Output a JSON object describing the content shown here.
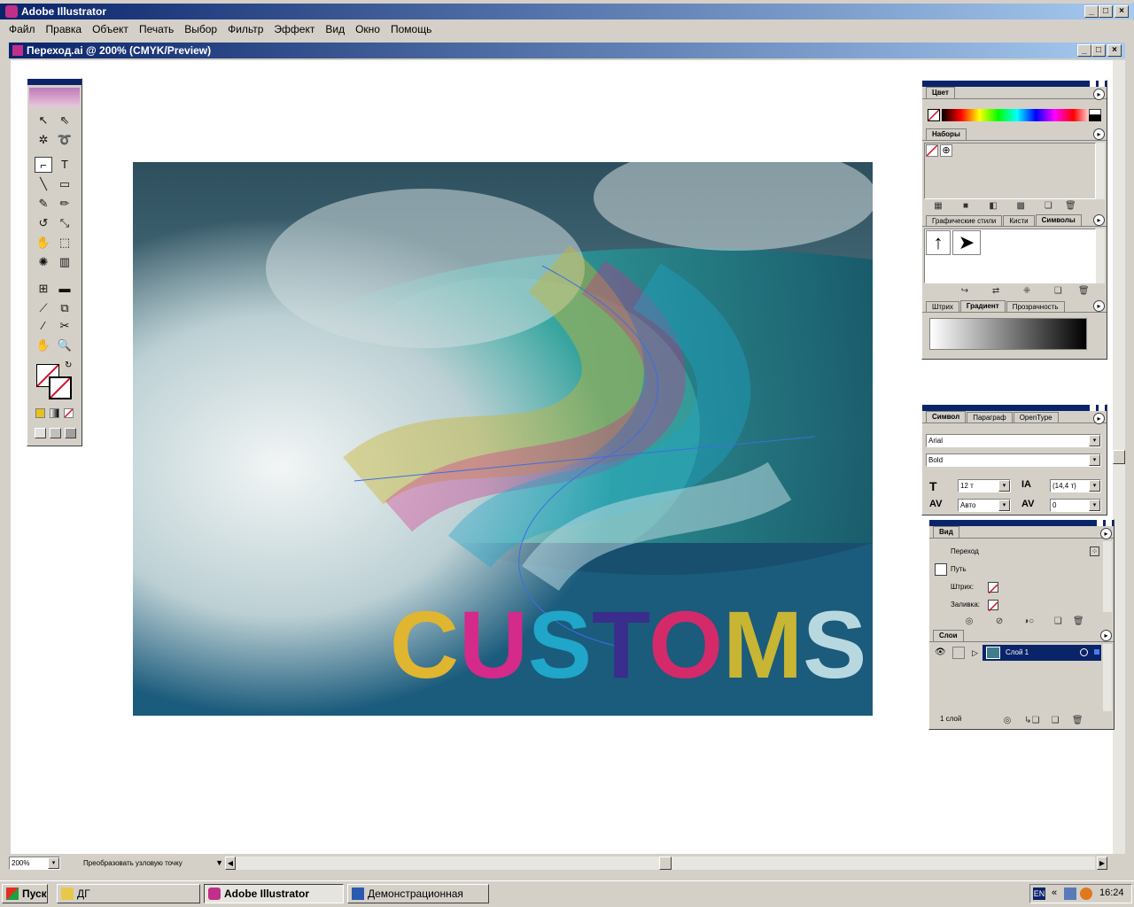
{
  "app": {
    "title": "Adobe Illustrator"
  },
  "menu": [
    "Файл",
    "Правка",
    "Объект",
    "Печать",
    "Выбор",
    "Фильтр",
    "Эффект",
    "Вид",
    "Окно",
    "Помощь"
  ],
  "document": {
    "title": "Переход.ai @ 200% (CMYK/Preview)"
  },
  "artwork": {
    "text": "CUSTOMS",
    "letters": [
      {
        "ch": "C",
        "color": "#e0b530"
      },
      {
        "ch": "U",
        "color": "#d42a8a"
      },
      {
        "ch": "S",
        "color": "#1fa6c8"
      },
      {
        "ch": "T",
        "color": "#3a2d8c"
      },
      {
        "ch": "O",
        "color": "#d42a6a"
      },
      {
        "ch": "M",
        "color": "#c8b534"
      },
      {
        "ch": "S",
        "color": "#b8d8e0"
      }
    ]
  },
  "panels": {
    "color": {
      "tab": "Цвет"
    },
    "swatches": {
      "tab": "Наборы"
    },
    "styles": {
      "tabs": [
        "Графические стили",
        "Кисти",
        "Символы"
      ]
    },
    "stroke": {
      "tabs": [
        "Штрих",
        "Градиент",
        "Прозрачность"
      ],
      "active": "Градиент"
    },
    "character": {
      "tabs": [
        "Символ",
        "Параграф",
        "OpenType"
      ],
      "font": "Arial",
      "style": "Bold",
      "size": "12 т",
      "leading": "(14,4 т)",
      "kerning": "Авто",
      "tracking": "0"
    },
    "appearance": {
      "tab": "Вид",
      "object": "Переход",
      "rows": [
        "Путь",
        "Штрих:",
        "Заливка:"
      ]
    },
    "layers": {
      "tab": "Слои",
      "layer": "Слой 1",
      "count": "1 слой"
    }
  },
  "statusbar": {
    "zoom": "200%",
    "tool": "Преобразовать узловую точку"
  },
  "taskbar": {
    "start": "Пуск",
    "items": [
      "ДГ",
      "Adobe Illustrator",
      "Демонстрационная гра..."
    ],
    "lang": "EN",
    "clock": "16:24"
  }
}
